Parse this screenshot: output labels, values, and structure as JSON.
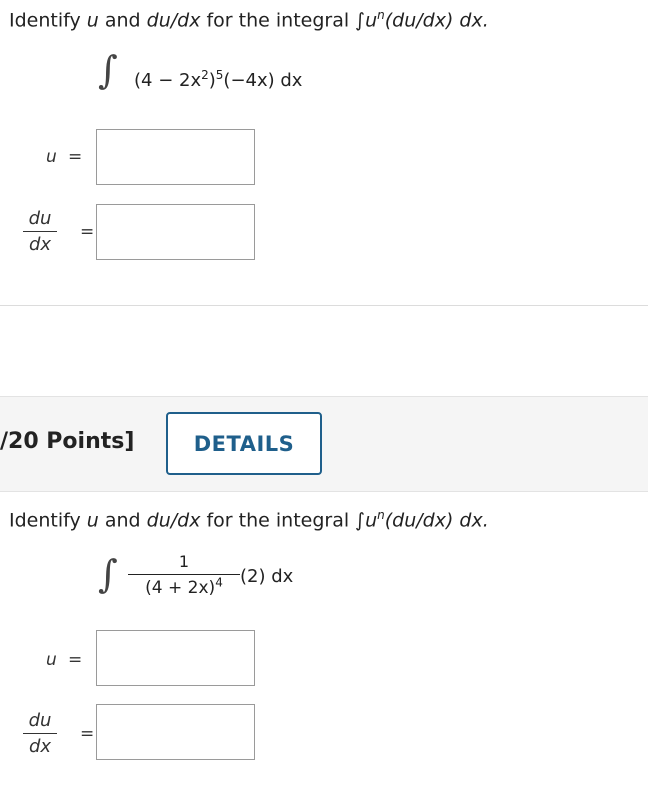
{
  "problem1": {
    "prompt_prefix": "Identify ",
    "prompt_u": "u",
    "prompt_and": " and ",
    "prompt_dudx": "du/dx",
    "prompt_middle": " for the integral ",
    "prompt_form": "∫u",
    "prompt_n": "n",
    "prompt_form_rest": "(du/dx) dx.",
    "integral_sign": "∫",
    "integrand_a": "(4 − 2x",
    "integrand_exp_inner": "2",
    "integrand_b": ")",
    "integrand_exp_outer": "5",
    "integrand_c": "(−4x) dx",
    "u_label": "u",
    "equals": "=",
    "du_num": "du",
    "du_den": "dx",
    "u_value": "",
    "dudx_value": ""
  },
  "problem2": {
    "points_label": "/20 Points]",
    "details_button": "DETAILS",
    "prompt_prefix": "Identify ",
    "prompt_u": "u",
    "prompt_and": " and ",
    "prompt_dudx": "du/dx",
    "prompt_middle": " for the integral ",
    "prompt_form": "∫u",
    "prompt_n": "n",
    "prompt_form_rest": "(du/dx) dx.",
    "integral_sign": "∫",
    "frac_num": "1",
    "frac_den": "(4 + 2x)",
    "frac_den_exp": "4",
    "integrand_tail": "(2) dx",
    "u_label": "u",
    "equals": "=",
    "du_num": "du",
    "du_den": "dx",
    "u_value": "",
    "dudx_value": ""
  }
}
